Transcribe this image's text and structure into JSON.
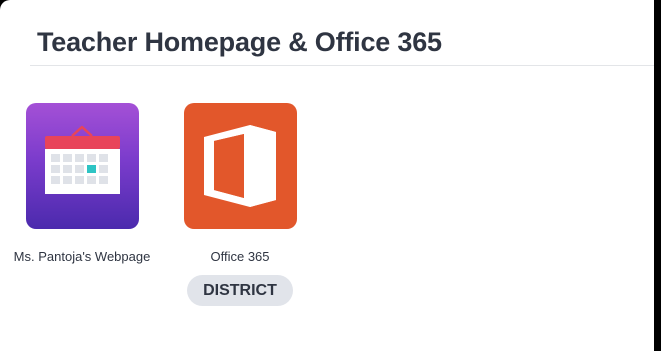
{
  "section": {
    "title": "Teacher Homepage & Office 365"
  },
  "apps": [
    {
      "label": "Ms. Pantoja's Webpage",
      "icon": "calendar-icon",
      "icon_colors": [
        "#a450d6",
        "#4b2aad",
        "#e8445a",
        "#2ec4c4"
      ]
    },
    {
      "label": "Office 365",
      "icon": "office-logo-icon",
      "icon_colors": [
        "#e2572b",
        "#ffffff"
      ],
      "badge": "DISTRICT"
    }
  ]
}
